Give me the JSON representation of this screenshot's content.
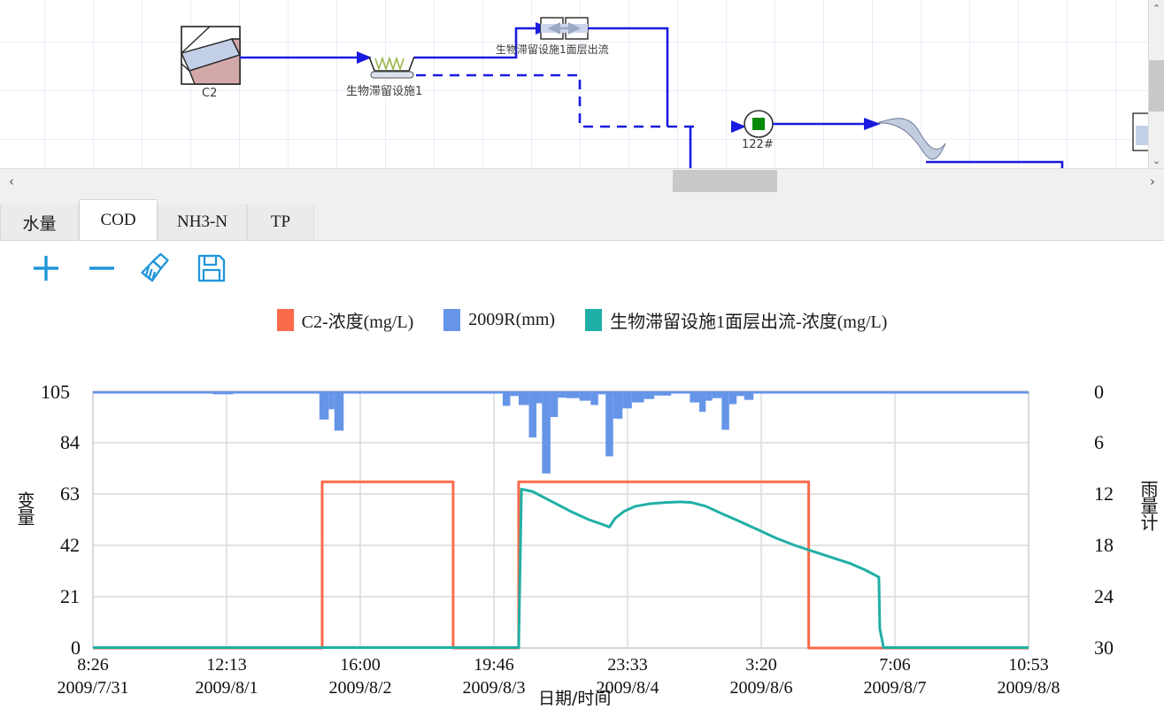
{
  "schematic": {
    "nodes": [
      {
        "id": "c2",
        "label": "C2",
        "icon": "subcatchment-icon"
      },
      {
        "id": "bio1",
        "label": "生物滞留设施1",
        "icon": "bioretention-icon"
      },
      {
        "id": "bio1_surface_out",
        "label": "生物滞留设施1面层出流",
        "icon": "flow-divider-icon"
      },
      {
        "id": "junction122",
        "label": "122#",
        "icon": "junction-node-icon"
      }
    ],
    "scroll": {
      "h_arrow_left": "‹",
      "h_arrow_right": "›",
      "v_arrow_up": "⌃",
      "v_arrow_down": "⌄"
    }
  },
  "tabs": [
    {
      "label": "水量",
      "active": false
    },
    {
      "label": "COD",
      "active": true
    },
    {
      "label": "NH3-N",
      "active": false
    },
    {
      "label": "TP",
      "active": false
    }
  ],
  "toolbar": [
    {
      "name": "zoom-in-button",
      "icon": "plus-icon"
    },
    {
      "name": "zoom-out-button",
      "icon": "minus-icon"
    },
    {
      "name": "clear-button",
      "icon": "broom-icon"
    },
    {
      "name": "save-button",
      "icon": "floppy-save-icon"
    }
  ],
  "colors": {
    "series_c2": "#FB6B4B",
    "series_rain": "#6695E8",
    "series_outflow": "#20AFA6",
    "toolbar_icon": "#2196DA",
    "link_line": "#1A1AE0",
    "grid": "#d9d9d9"
  },
  "chart_data": {
    "type": "line",
    "title": "",
    "xlabel": "日期/时间",
    "ylabel": "变量",
    "y2label": "雨量计",
    "ylim": [
      0,
      105
    ],
    "yticks": [
      "0",
      "21",
      "42",
      "63",
      "84",
      "105"
    ],
    "y2lim": [
      0,
      30
    ],
    "y2ticks": [
      "0",
      "6",
      "12",
      "18",
      "24",
      "30"
    ],
    "y2_inverted": true,
    "grid": true,
    "legend_position": "top-center",
    "xticks": [
      {
        "time": "8:26",
        "date": "2009/7/31"
      },
      {
        "time": "12:13",
        "date": "2009/8/1"
      },
      {
        "time": "16:00",
        "date": "2009/8/2"
      },
      {
        "time": "19:46",
        "date": "2009/8/3"
      },
      {
        "time": "23:33",
        "date": "2009/8/4"
      },
      {
        "time": "3:20",
        "date": "2009/8/6"
      },
      {
        "time": "7:06",
        "date": "2009/8/7"
      },
      {
        "time": "10:53",
        "date": "2009/8/8"
      }
    ],
    "series": [
      {
        "name": "C2-浓度(mg/L)",
        "color": "#FB6B4B",
        "axis": "left",
        "unit": "mg/L",
        "points": [
          [
            0.0,
            0
          ],
          [
            0.245,
            0
          ],
          [
            0.245,
            68
          ],
          [
            0.385,
            68
          ],
          [
            0.385,
            0
          ],
          [
            0.455,
            0
          ],
          [
            0.455,
            68
          ],
          [
            0.765,
            68
          ],
          [
            0.765,
            0
          ],
          [
            1.0,
            0
          ]
        ]
      },
      {
        "name": "2009R(mm)",
        "color": "#6695E8",
        "axis": "right",
        "unit": "mm",
        "bars": [
          [
            0.082,
            0.0
          ],
          [
            0.11,
            0.0
          ],
          [
            0.128,
            0.35
          ],
          [
            0.15,
            0.0
          ],
          [
            0.175,
            0.0
          ],
          [
            0.238,
            0.0
          ],
          [
            0.242,
            3.3
          ],
          [
            0.252,
            2.1
          ],
          [
            0.258,
            4.6
          ],
          [
            0.268,
            0.0
          ],
          [
            0.43,
            0.0
          ],
          [
            0.438,
            1.7
          ],
          [
            0.446,
            0.55
          ],
          [
            0.455,
            1.6
          ],
          [
            0.466,
            5.4
          ],
          [
            0.474,
            1.4
          ],
          [
            0.48,
            9.6
          ],
          [
            0.489,
            3.0
          ],
          [
            0.497,
            0.75
          ],
          [
            0.506,
            0.8
          ],
          [
            0.52,
            1.1
          ],
          [
            0.532,
            1.6
          ],
          [
            0.54,
            0.35
          ],
          [
            0.548,
            7.6
          ],
          [
            0.556,
            3.2
          ],
          [
            0.566,
            2.0
          ],
          [
            0.576,
            1.3
          ],
          [
            0.589,
            0.9
          ],
          [
            0.6,
            0.5
          ],
          [
            0.618,
            0.0
          ],
          [
            0.625,
            0.0
          ],
          [
            0.638,
            1.3
          ],
          [
            0.648,
            2.4
          ],
          [
            0.655,
            1.1
          ],
          [
            0.662,
            0.8
          ],
          [
            0.672,
            4.5
          ],
          [
            0.68,
            1.5
          ],
          [
            0.688,
            0.55
          ],
          [
            0.696,
            1.0
          ],
          [
            0.706,
            0.0
          ]
        ]
      },
      {
        "name": "生物滞留设施1面层出流-浓度(mg/L)",
        "color": "#20AFA6",
        "axis": "left",
        "unit": "mg/L",
        "points": [
          [
            0.0,
            0.2
          ],
          [
            0.455,
            0.2
          ],
          [
            0.458,
            65
          ],
          [
            0.47,
            64
          ],
          [
            0.49,
            60
          ],
          [
            0.51,
            56
          ],
          [
            0.53,
            52.5
          ],
          [
            0.545,
            50.5
          ],
          [
            0.552,
            49.5
          ],
          [
            0.558,
            53
          ],
          [
            0.568,
            56
          ],
          [
            0.58,
            58
          ],
          [
            0.595,
            59
          ],
          [
            0.612,
            59.5
          ],
          [
            0.628,
            59.8
          ],
          [
            0.64,
            59.5
          ],
          [
            0.655,
            58
          ],
          [
            0.672,
            55
          ],
          [
            0.69,
            52
          ],
          [
            0.71,
            48.5
          ],
          [
            0.73,
            45
          ],
          [
            0.75,
            42
          ],
          [
            0.77,
            39.5
          ],
          [
            0.79,
            37
          ],
          [
            0.81,
            34.5
          ],
          [
            0.825,
            32
          ],
          [
            0.835,
            30
          ],
          [
            0.84,
            29
          ],
          [
            0.841,
            8
          ],
          [
            0.845,
            0.2
          ],
          [
            1.0,
            0.2
          ]
        ]
      }
    ]
  }
}
